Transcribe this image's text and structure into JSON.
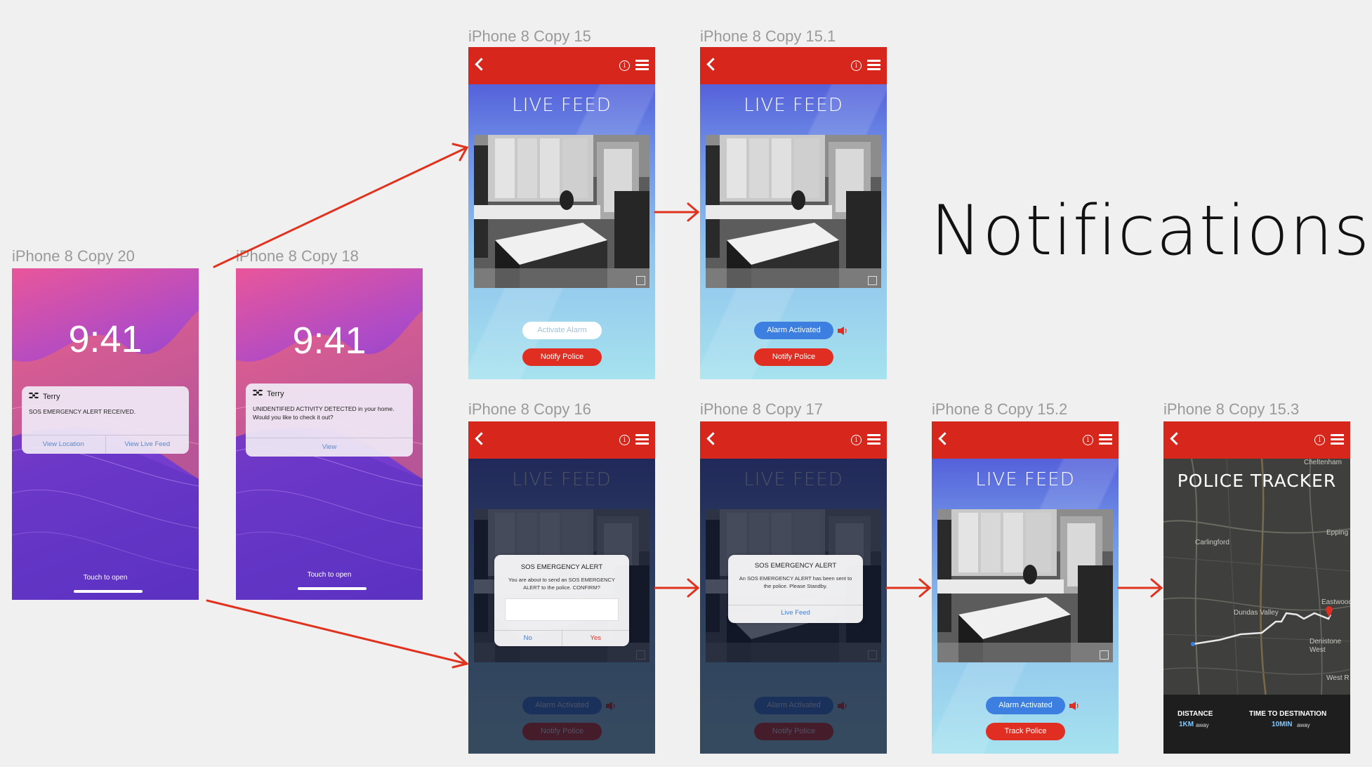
{
  "page_title": "Notifications",
  "artboards": {
    "copy20": "iPhone 8 Copy 20",
    "copy18": "iPhone 8 Copy 18",
    "copy15": "iPhone 8 Copy 15",
    "copy15_1": "iPhone 8 Copy 15.1",
    "copy16": "iPhone 8 Copy 16",
    "copy17": "iPhone 8 Copy 17",
    "copy15_2": "iPhone 8 Copy 15.2",
    "copy15_3": "iPhone 8 Copy 15.3"
  },
  "lock_screen": {
    "time": "9:41",
    "touch_to_open": "Touch to open"
  },
  "notif_sos": {
    "sender": "Terry",
    "message": "SOS EMERGENCY ALERT RECEIVED.",
    "view_location": "View Location",
    "view_live_feed": "View Live Feed"
  },
  "notif_activity": {
    "sender": "Terry",
    "message": "UNIDENTIFIED ACTIVITY DETECTED in your home. Would you like to check it out?",
    "view": "View"
  },
  "app": {
    "live_feed_title": "LIVE FEED",
    "info_glyph": "i",
    "activate_alarm": "Activate Alarm",
    "alarm_activated": "Alarm Activated",
    "notify_police": "Notify Police",
    "track_police": "Track Police"
  },
  "dialog_confirm": {
    "title": "SOS EMERGENCY ALERT",
    "message": "You are about to send an SOS EMERGENCY ALERT to the police. CONFIRM?",
    "no": "No",
    "yes": "Yes"
  },
  "dialog_sent": {
    "title": "SOS EMERGENCY ALERT",
    "message": "An SOS EMERGENCY ALERT has been sent to the police. Please Standby.",
    "live_feed": "Live Feed"
  },
  "tracker": {
    "title": "POLICE TRACKER",
    "places": [
      "Cheltenham",
      "Carlingford",
      "Epping",
      "Dundas Valley",
      "Eastwood",
      "Denistone West",
      "West R"
    ],
    "distance_label": "DISTANCE",
    "distance_value": "1KM",
    "distance_suffix": "away",
    "eta_label": "TIME TO DESTINATION",
    "eta_value": "10MIN",
    "eta_suffix": "away"
  },
  "colors": {
    "header_red": "#d7271d",
    "arrow_red": "#e0331f",
    "alarm_blue": "#3d7fe0"
  }
}
